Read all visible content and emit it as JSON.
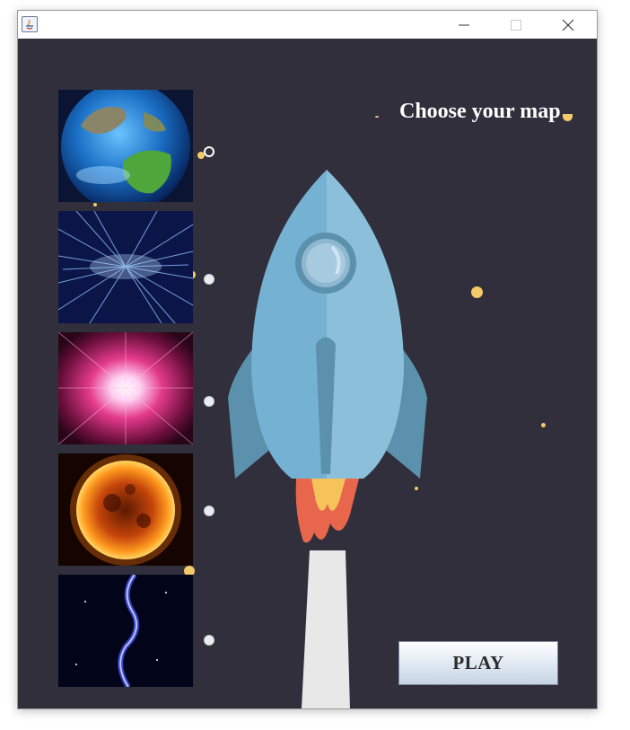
{
  "window": {
    "title": "",
    "controls": {
      "minimize": "minimize-icon",
      "maximize": "maximize-icon",
      "close": "close-icon"
    }
  },
  "main": {
    "heading": "Choose your map",
    "play_label": "PLAY"
  },
  "maps": [
    {
      "name": "earth",
      "selected": true
    },
    {
      "name": "hyperspace",
      "selected": false
    },
    {
      "name": "nebula-burst",
      "selected": false
    },
    {
      "name": "sun",
      "selected": false
    },
    {
      "name": "blue-galaxy",
      "selected": false
    }
  ],
  "colors": {
    "background": "#302f3b",
    "star": "#f4c96a",
    "rocket_body": "#74b1d2",
    "rocket_fins": "#5b91ac",
    "flame": "#e8674c"
  }
}
